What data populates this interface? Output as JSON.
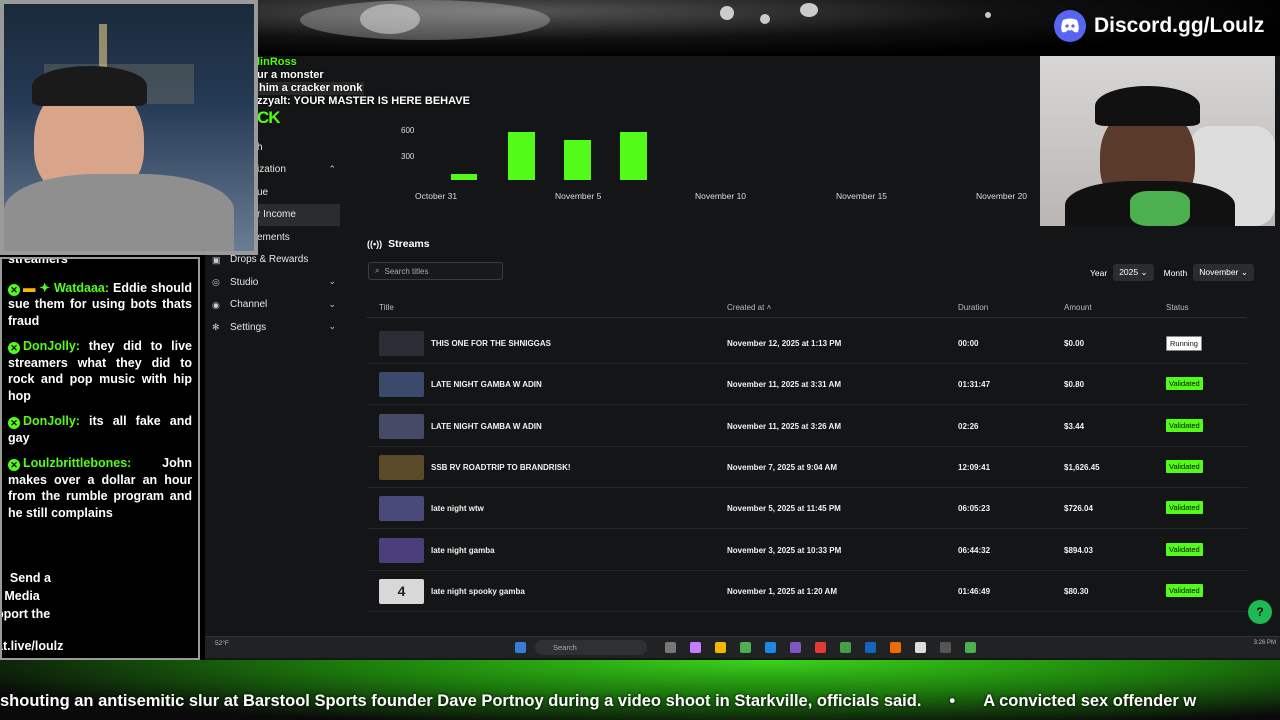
{
  "overlay": {
    "discord_text": "Discord.gg/Loulz",
    "ticker_items": [
      "shouting an antisemitic slur at Barstool Sports founder Dave Portnoy during a video shoot in Starkville, officials said.",
      "A convicted sex offender w"
    ],
    "ticker_separator": "•"
  },
  "screen_chat": {
    "line1": "linRoss",
    "line2": "ur a monster",
    "line3": "him a cracker monk",
    "line4": "zzyalt: YOUR MASTER IS HERE BEHAVE"
  },
  "app": {
    "logo_fragment": "CK",
    "sidebar": [
      {
        "label": "h",
        "indent": true
      },
      {
        "label": "ization",
        "indent": true,
        "chevron": "▲"
      },
      {
        "label": "ue",
        "indent": true
      },
      {
        "label": "r Income",
        "indent": true,
        "active": true
      },
      {
        "label": "ements",
        "indent": true
      },
      {
        "label": "Drops & Rewards",
        "icon": "gift-icon"
      },
      {
        "label": "Studio",
        "icon": "video-icon",
        "chevron": "▼"
      },
      {
        "label": "Channel",
        "icon": "broadcast-icon",
        "chevron": "▼"
      },
      {
        "label": "Settings",
        "icon": "gear-icon",
        "chevron": "▼"
      }
    ],
    "chart_data": {
      "type": "bar",
      "y_ticks": [
        "600",
        "300"
      ],
      "x_labels": [
        "October 31",
        "November 5",
        "November 10",
        "November 15",
        "November 20"
      ],
      "bars": [
        {
          "value": 80
        },
        {
          "value": 894
        },
        {
          "value": 726
        },
        {
          "value": 1626
        }
      ],
      "bar_color": "#53fc18"
    },
    "streams": {
      "title": "Streams",
      "search_placeholder": "Search titles",
      "year_label": "Year",
      "year_value": "2025",
      "month_label": "Month",
      "month_value": "November",
      "columns": {
        "title": "Title",
        "created": "Created at",
        "duration": "Duration",
        "amount": "Amount",
        "status": "Status"
      },
      "rows": [
        {
          "title": "THIS ONE FOR THE SHNIGGAS",
          "created": "November 12, 2025 at 1:13 PM",
          "duration": "00:00",
          "amount": "$0.00",
          "status": "Running",
          "thumb": "#2b2e35"
        },
        {
          "title": "LATE NIGHT GAMBA W ADIN",
          "created": "November 11, 2025 at 3:31 AM",
          "duration": "01:31:47",
          "amount": "$0.80",
          "status": "Validated",
          "thumb": "#3b4a6a"
        },
        {
          "title": "LATE NIGHT GAMBA W ADIN",
          "created": "November 11, 2025 at 3:26 AM",
          "duration": "02:26",
          "amount": "$3.44",
          "status": "Validated",
          "thumb": "#454a66"
        },
        {
          "title": "SSB RV ROADTRIP TO BRANDRISK!",
          "created": "November 7, 2025 at 9:04 AM",
          "duration": "12:09:41",
          "amount": "$1,626.45",
          "status": "Validated",
          "thumb": "#5a4a2a"
        },
        {
          "title": "late night wtw",
          "created": "November 5, 2025 at 11:45 PM",
          "duration": "06:05:23",
          "amount": "$726.04",
          "status": "Validated",
          "thumb": "#4a4a7a"
        },
        {
          "title": "late night gamba",
          "created": "November 3, 2025 at 10:33 PM",
          "duration": "06:44:32",
          "amount": "$894.03",
          "status": "Validated",
          "thumb": "#4a3f7a"
        },
        {
          "title": "late night spooky gamba",
          "created": "November 1, 2025 at 1:20 AM",
          "duration": "01:46:49",
          "amount": "$80.30",
          "status": "Validated",
          "thumb": "#d8d8d8",
          "thumb_text": "4"
        }
      ]
    }
  },
  "taskbar": {
    "weather": "52°F",
    "search_placeholder": "Search",
    "clock": "3:26 PM"
  },
  "chat": {
    "messages": [
      {
        "user": "streamers",
        "text": "",
        "partial": true
      },
      {
        "user": "Watdaaa:",
        "text": "Eddie should sue them for using bots thats fraud"
      },
      {
        "user": "DonJolly:",
        "text": "they did to live streamers what they did to rock and pop music with hip hop"
      },
      {
        "user": "DonJolly:",
        "text": "its all fake and gay"
      },
      {
        "user": "Loulzbrittlebones:",
        "text": "John makes over a dollar an hour from the rumble program and he still complains"
      }
    ],
    "footer_lines": [
      "Send a",
      "r Media",
      "pport the",
      "at.live/loulz"
    ]
  }
}
